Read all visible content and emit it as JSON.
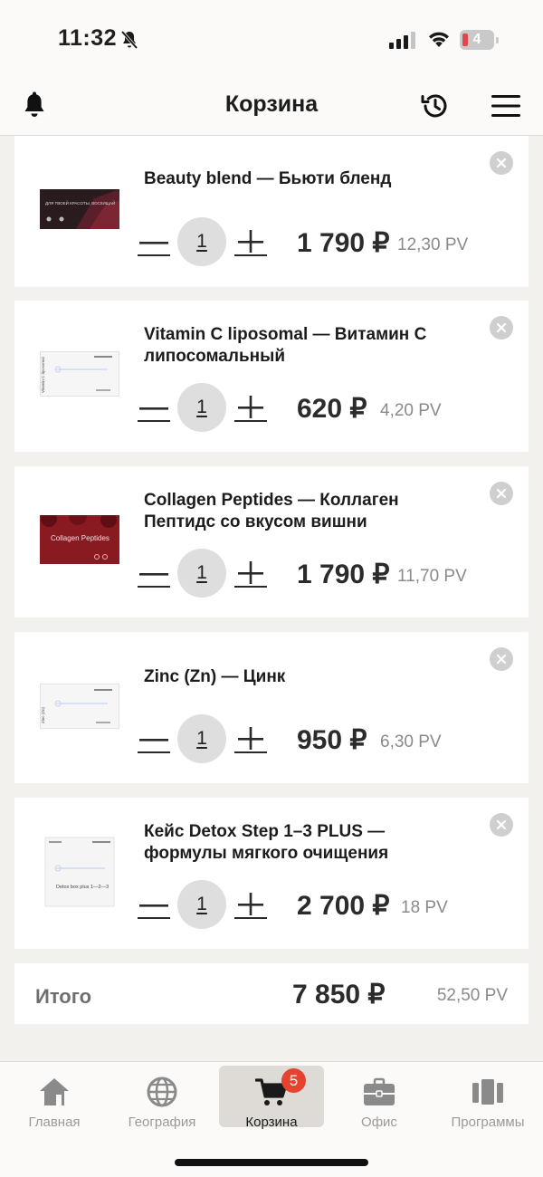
{
  "status_bar": {
    "time": "11:32",
    "battery": "4"
  },
  "header": {
    "title": "Корзина"
  },
  "cart": {
    "items": [
      {
        "name": "Beauty blend — Бьюти бленд",
        "quantity": "1",
        "price": "1 790 ₽",
        "pv": "12,30 PV",
        "thumb_text": "ДЛЯ ТВОЕЙ КРАСОТЫ, ВОСХИЩАЙ",
        "thumb_style": "dark"
      },
      {
        "name": "Vitamin C liposomal — Витамин С липосомальный",
        "quantity": "1",
        "price": "620 ₽",
        "pv": "4,20 PV",
        "thumb_text": "Vitamin C liposomal",
        "thumb_style": "white"
      },
      {
        "name": "Collagen Peptides — Коллаген Пептидс со вкусом вишни",
        "quantity": "1",
        "price": "1 790 ₽",
        "pv": "11,70 PV",
        "thumb_text": "Collagen Peptides",
        "thumb_style": "red"
      },
      {
        "name": "Zinc (Zn) — Цинк",
        "quantity": "1",
        "price": "950 ₽",
        "pv": "6,30 PV",
        "thumb_text": "Zinc (Zn)",
        "thumb_style": "white"
      },
      {
        "name": "Кейс Detox Step 1–3 PLUS — формулы мягкого очищения",
        "quantity": "1",
        "price": "2 700 ₽",
        "pv": "18 PV",
        "thumb_text": "Detox box plus 1—2—3",
        "thumb_style": "box"
      }
    ],
    "total_label": "Итого",
    "total_sum": "7 850 ₽",
    "total_pv": "52,50 PV"
  },
  "nav": {
    "items": [
      {
        "label": "Главная",
        "icon": "home-icon"
      },
      {
        "label": "География",
        "icon": "globe-icon"
      },
      {
        "label": "Корзина",
        "icon": "cart-icon",
        "badge": "5",
        "active": true
      },
      {
        "label": "Офис",
        "icon": "briefcase-icon"
      },
      {
        "label": "Программы",
        "icon": "programs-icon"
      }
    ]
  },
  "colors": {
    "badge": "#e5422f",
    "active_nav_bg": "#dedbd6",
    "background": "#f3f1ee"
  }
}
